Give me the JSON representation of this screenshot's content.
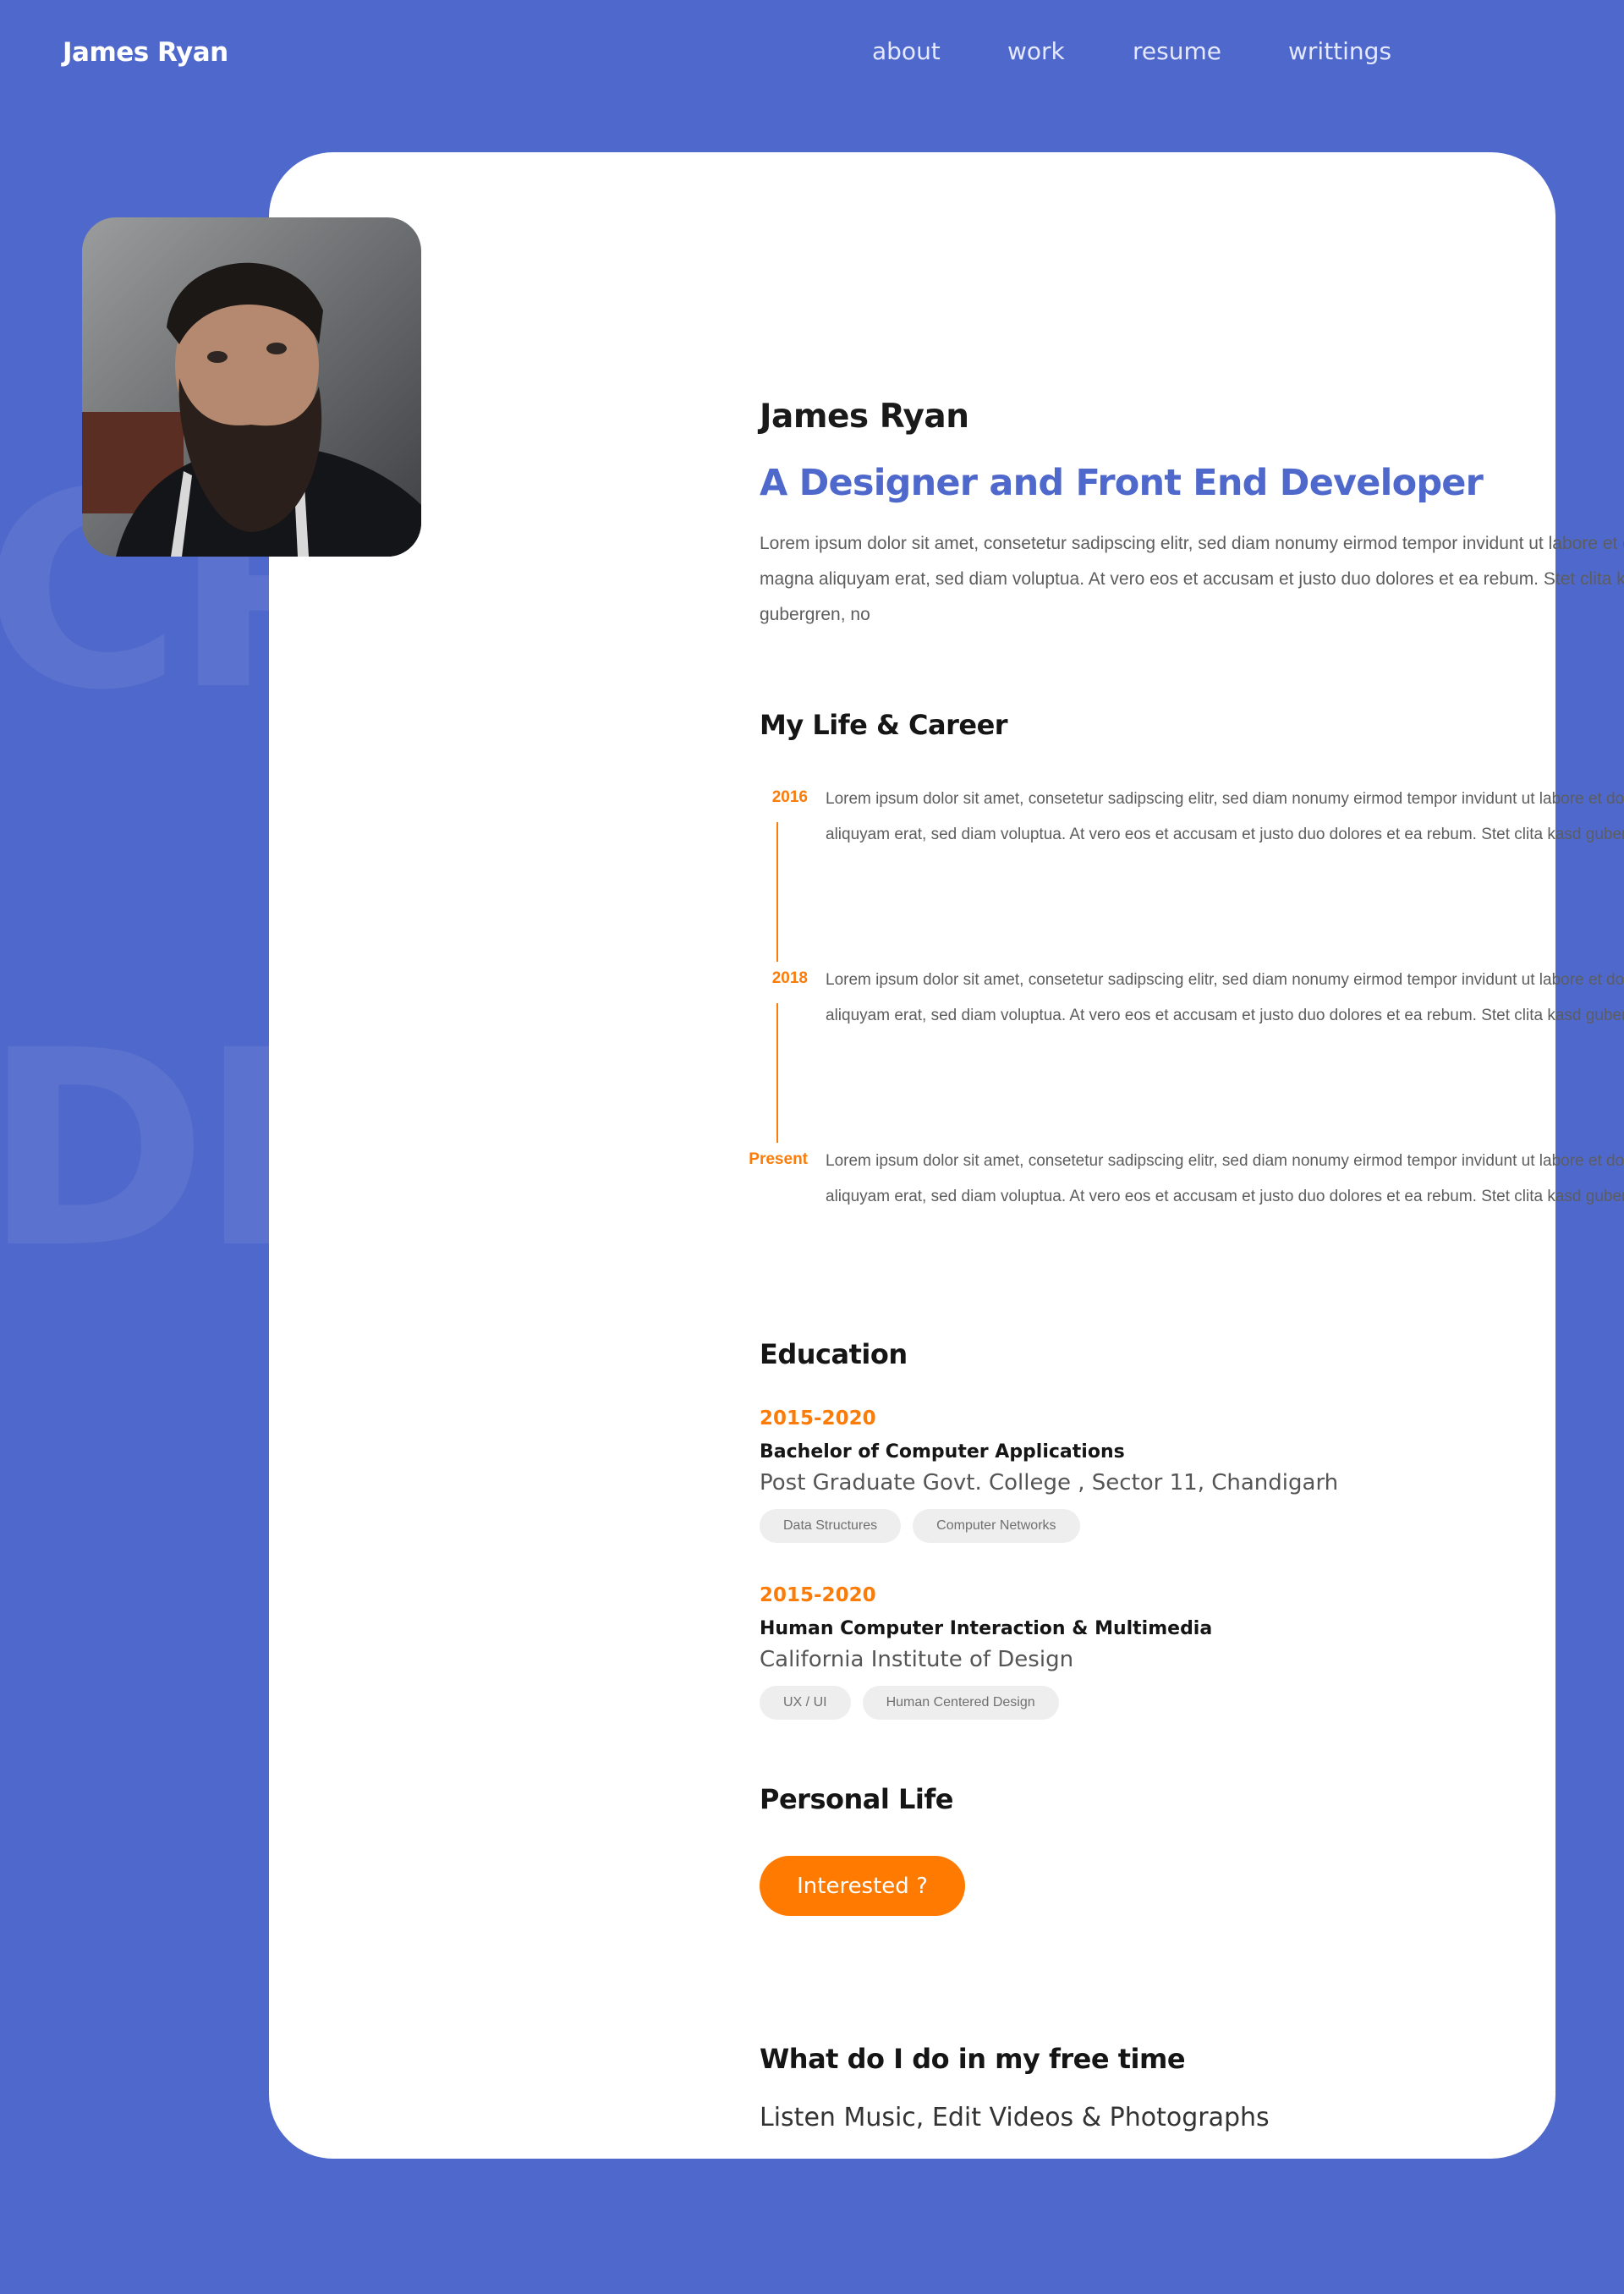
{
  "header": {
    "brand": "James Ryan",
    "nav": [
      "about",
      "work",
      "resume",
      "writtings"
    ]
  },
  "background_letters": [
    "CR",
    "DE"
  ],
  "profile": {
    "name": "James Ryan",
    "role": "A Designer and Front End Developer",
    "bio": "Lorem ipsum dolor sit amet, consetetur sadipscing elitr, sed diam nonumy eirmod tempor invidunt ut labore et dolore magna aliquyam erat, sed diam voluptua. At vero eos et accusam et justo duo dolores et ea rebum. Stet clita kasd gubergren, no"
  },
  "career": {
    "title": "My Life & Career",
    "items": [
      {
        "year": "2016",
        "text": "Lorem ipsum dolor sit amet, consetetur sadipscing elitr, sed diam nonumy eirmod tempor invidunt ut labore et dolore magna aliquyam erat, sed diam voluptua. At vero eos et accusam et justo duo dolores et ea rebum. Stet clita kasd gubergren, no"
      },
      {
        "year": "2018",
        "text": "Lorem ipsum dolor sit amet, consetetur sadipscing elitr, sed diam nonumy eirmod tempor invidunt ut labore et dolore magna aliquyam erat, sed diam voluptua. At vero eos et accusam et justo duo dolores et ea rebum. Stet clita kasd gubergren, no"
      },
      {
        "year": "Present",
        "text": "Lorem ipsum dolor sit amet, consetetur sadipscing elitr, sed diam nonumy eirmod tempor invidunt ut labore et dolore magna aliquyam erat, sed diam voluptua. At vero eos et accusam et justo duo dolores et ea rebum. Stet clita kasd gubergren, no"
      }
    ]
  },
  "education": {
    "title": "Education",
    "items": [
      {
        "years": "2015-2020",
        "degree": "Bachelor of Computer Applications",
        "school": "Post Graduate Govt. College , Sector 11, Chandigarh",
        "tags": [
          "Data Structures",
          "Computer Networks"
        ]
      },
      {
        "years": "2015-2020",
        "degree": "Human Computer Interaction & Multimedia",
        "school": "California Institute of Design",
        "tags": [
          "UX /  UI",
          "Human Centered Design"
        ]
      }
    ]
  },
  "personal": {
    "title": "Personal Life",
    "button": "Interested ?"
  },
  "free_time": {
    "title": "What do I do in my free time",
    "text": "Listen Music, Edit Videos & Photographs"
  },
  "colors": {
    "background": "#4f68cb",
    "accent": "#ff7a00",
    "role_text": "#4f68cb"
  }
}
